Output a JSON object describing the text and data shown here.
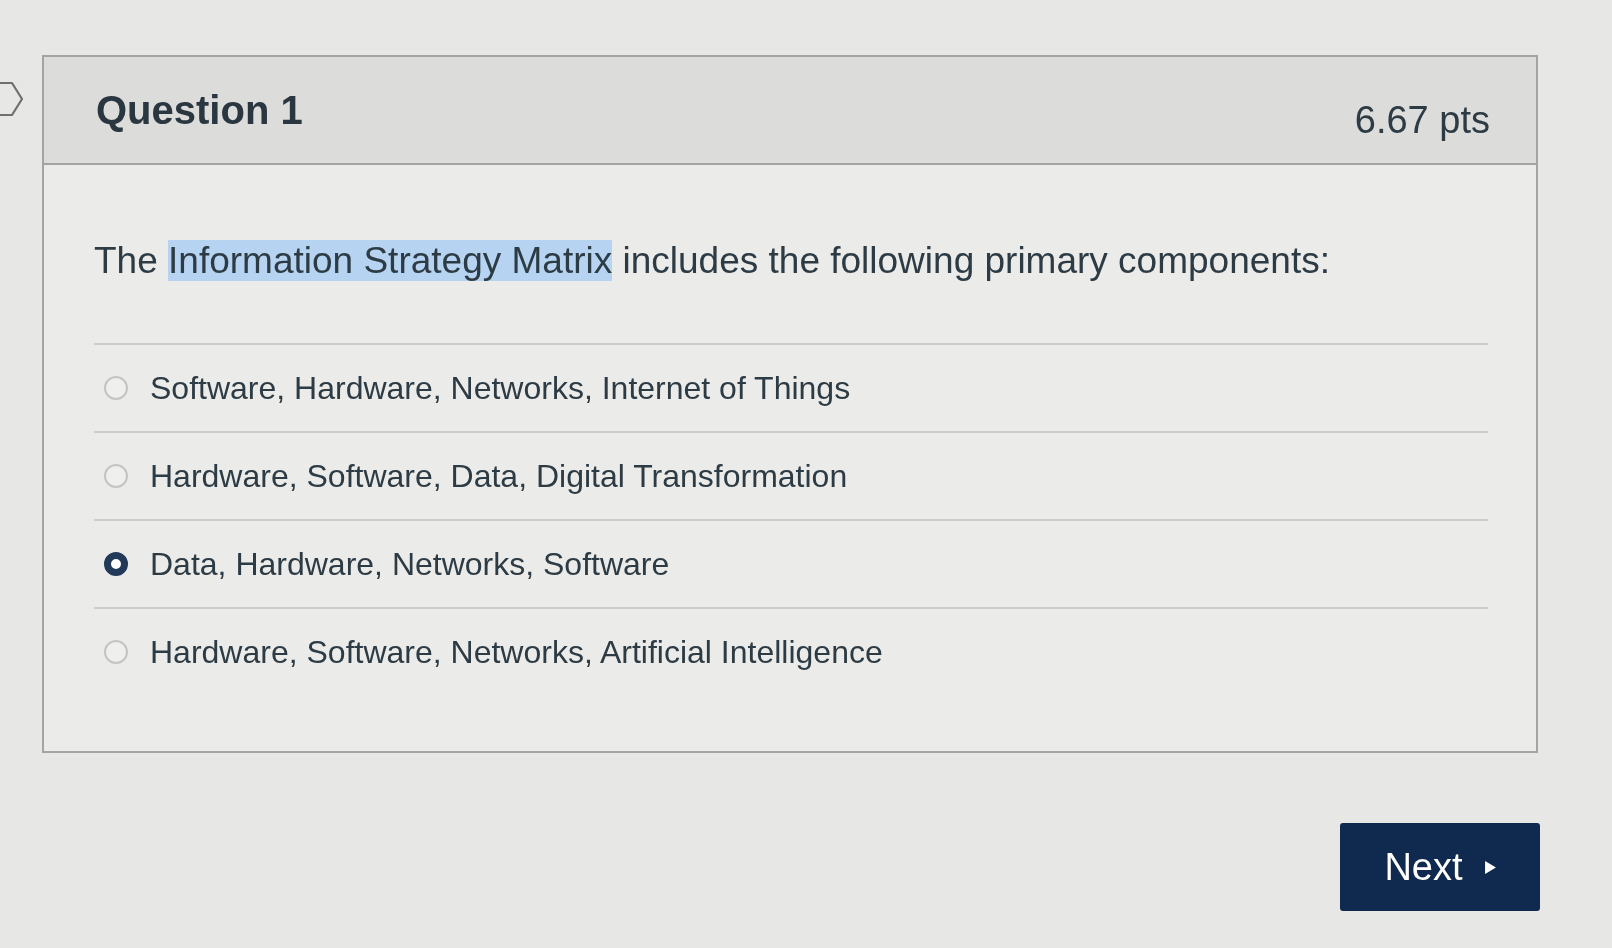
{
  "question": {
    "title": "Question 1",
    "points": "6.67 pts",
    "prompt": [
      {
        "text": "The ",
        "highlighted": false
      },
      {
        "text": "Information Strategy Matrix",
        "highlighted": true
      },
      {
        "text": " includes the following primary components:",
        "highlighted": false
      }
    ]
  },
  "answers": [
    {
      "label": "Software, Hardware, Networks, Internet of Things",
      "selected": false
    },
    {
      "label": "Hardware, Software, Data, Digital Transformation",
      "selected": false
    },
    {
      "label": "Data, Hardware, Networks, Software",
      "selected": true
    },
    {
      "label": "Hardware, Software, Networks, Artificial Intelligence",
      "selected": false
    }
  ],
  "next_button": {
    "label": "Next"
  }
}
